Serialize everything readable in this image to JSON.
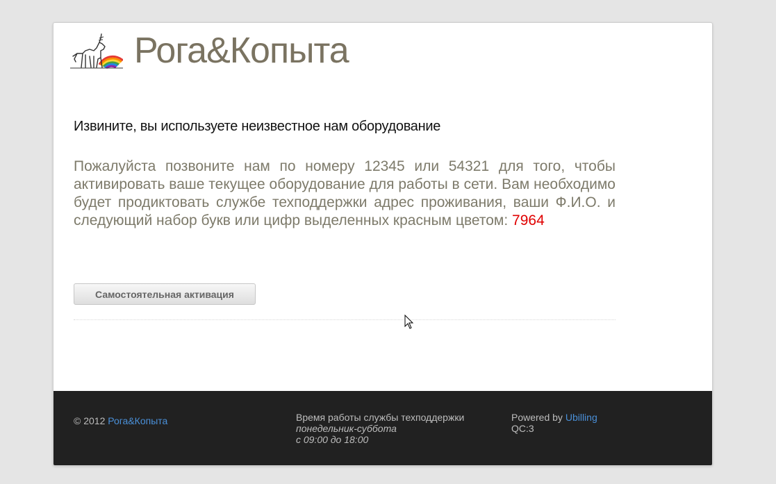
{
  "header": {
    "brand": "Рога&Копыта",
    "logo_icon": "unicorn-rainbow-logo-icon"
  },
  "main": {
    "title": "Извините, вы используете неизвестное нам оборудование",
    "message": "Пожалуйста позвоните нам по номеру 12345 или 54321 для того, чтобы активировать ваше текущее оборудование для работы в сети. Вам необходимо будет продиктовать службе техподдержки адрес проживания, ваши Ф.И.О. и следующий набор букв или цифр выделенных красным цветом:",
    "code": "7964",
    "activate_button": "Самостоятельная активация"
  },
  "footer": {
    "copyright_prefix": "© 2012",
    "copyright_link": "Рога&Копыта",
    "support_title": "Время работы службы техподдержки",
    "support_days": "понедельник-суббота",
    "support_hours": "с 09:00 до 18:00",
    "powered_prefix": "Powered by",
    "powered_link": "Ubilling",
    "qc": "QC:3"
  },
  "colors": {
    "brand": "#7a7361",
    "code": "#e00000",
    "link": "#4a90d9",
    "footer_bg": "#212121"
  }
}
